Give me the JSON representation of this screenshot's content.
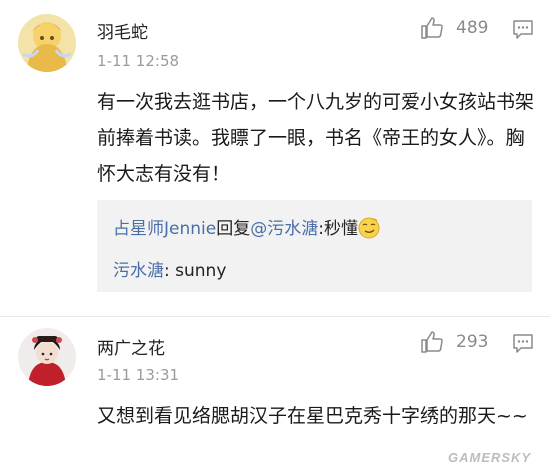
{
  "comments": [
    {
      "username": "羽毛蛇",
      "time": "1-11 12:58",
      "likes": "489",
      "text": "有一次我去逛书店，一个八九岁的可爱小女孩站书架前捧着书读。我瞟了一眼，书名《帝王的女人》。胸怀大志有没有！",
      "replies": [
        {
          "user": "占星师Jennie",
          "verb": "回复",
          "mention": "@污水溏",
          "sep": ":",
          "content": "秒懂",
          "emoji": "smirk-emoji"
        },
        {
          "user": "污水溏",
          "sep": ": ",
          "content": "sunny"
        }
      ]
    },
    {
      "username": "两广之花",
      "time": "1-11 13:31",
      "likes": "293",
      "text": "又想到看见络腮胡汉子在星巴克秀十字绣的那天~~"
    }
  ],
  "watermark": "GAMERSKY",
  "colors": {
    "link": "#4a6ea8",
    "time": "#9b9b9b",
    "reply_bg": "#f2f2f2"
  }
}
